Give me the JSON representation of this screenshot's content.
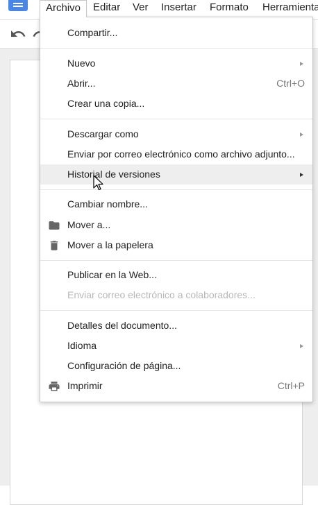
{
  "menubar": {
    "items": [
      "Archivo",
      "Editar",
      "Ver",
      "Insertar",
      "Formato",
      "Herramientas"
    ],
    "active": "Archivo"
  },
  "file_menu": {
    "compartir": "Compartir...",
    "nuevo": "Nuevo",
    "abrir": "Abrir...",
    "abrir_shortcut": "Ctrl+O",
    "crear_copia": "Crear una copia...",
    "descargar": "Descargar como",
    "enviar_adjunto": "Enviar por correo electrónico como archivo adjunto...",
    "historial": "Historial de versiones",
    "cambiar_nombre": "Cambiar nombre...",
    "mover": "Mover a...",
    "papelera": "Mover a la papelera",
    "publicar": "Publicar en la Web...",
    "enviar_colaboradores": "Enviar correo electrónico a colaboradores...",
    "detalles": "Detalles del documento...",
    "idioma": "Idioma",
    "configuracion": "Configuración de página...",
    "imprimir": "Imprimir",
    "imprimir_shortcut": "Ctrl+P"
  },
  "icons": {
    "logo": "docs-logo-icon",
    "undo": "undo-icon",
    "redo": "redo-icon",
    "folder": "folder-icon",
    "trash": "trash-icon",
    "print": "print-icon",
    "cursor": "mouse-pointer-icon"
  },
  "colors": {
    "brand": "#4a86e8",
    "hover_bg": "#eeeeee",
    "disabled_text": "#b8b8b8"
  }
}
